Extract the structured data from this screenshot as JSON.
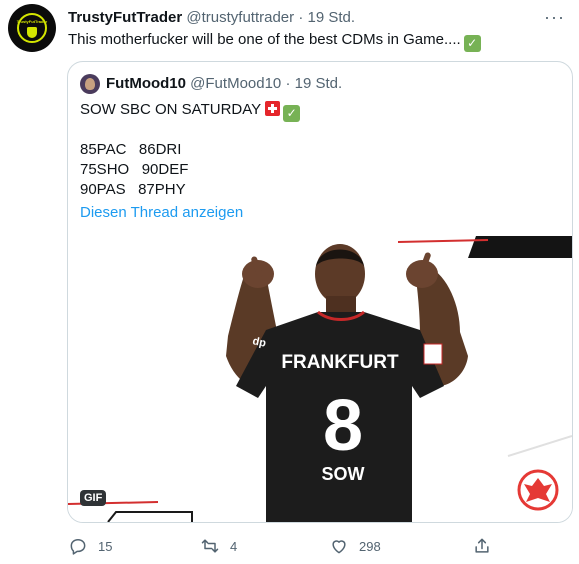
{
  "tweet": {
    "author_name": "TrustyFutTrader",
    "author_handle": "@trustyfuttrader",
    "separator": "·",
    "time": "19 Std.",
    "avatar_text": "TrustyFutTrader",
    "text": "This motherfucker will be one of the best CDMs in Game....",
    "more_label": "···"
  },
  "quote": {
    "author_name": "FutMood10",
    "author_handle": "@FutMood10",
    "separator": "·",
    "time": "19 Std.",
    "headline": "SOW SBC ON SATURDAY",
    "stats": [
      "85PAC   86DRI",
      "75SHO   90DEF",
      "90PAS   87PHY"
    ],
    "thread_link": "Diesen Thread anzeigen",
    "media": {
      "badge": "GIF",
      "jersey_club": "FRANKFURT",
      "jersey_number": "8",
      "jersey_name": "SOW",
      "sponsor": "dp"
    }
  },
  "actions": {
    "reply_count": "15",
    "retweet_count": "4",
    "like_count": "298",
    "share_label": ""
  },
  "colors": {
    "text": "#0f1419",
    "muted": "#536471",
    "link": "#1d9bf0",
    "border": "#cfd9de",
    "check_green": "#77b255",
    "swiss_red": "#e5262b"
  }
}
